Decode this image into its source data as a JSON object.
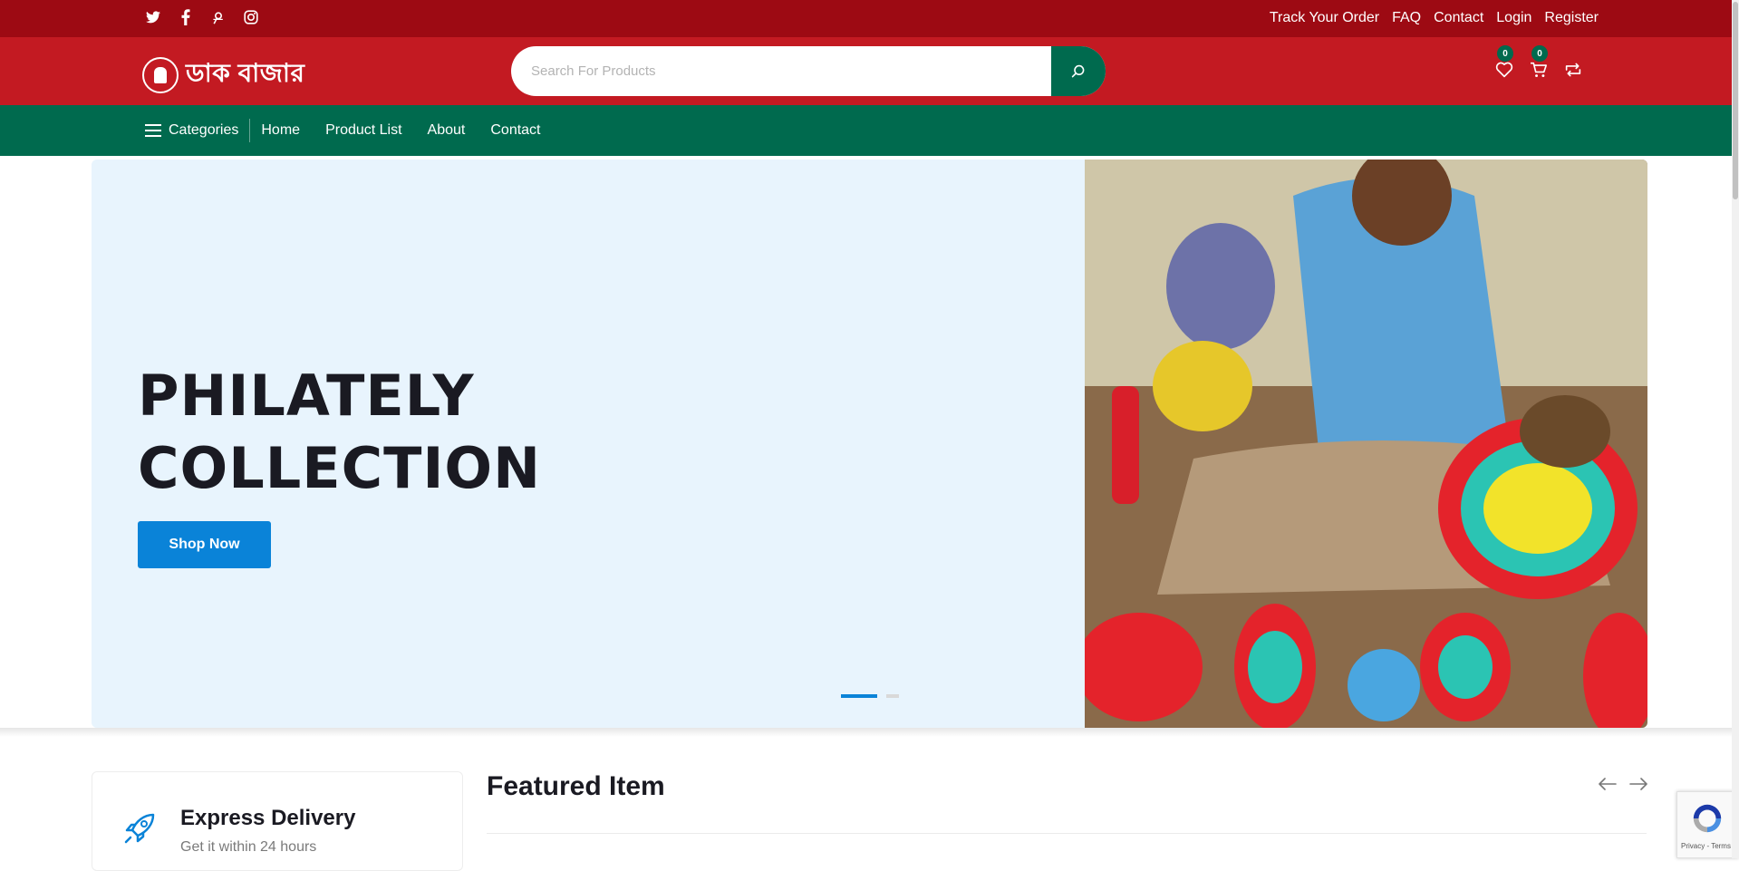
{
  "topbar": {
    "social": [
      "twitter-icon",
      "facebook-icon",
      "pinterest-icon",
      "instagram-icon"
    ],
    "links": [
      "Track Your Order",
      "FAQ",
      "Contact",
      "Login",
      "Register"
    ]
  },
  "header": {
    "logo_text": "ডাক বাজার",
    "search_placeholder": "Search For Products",
    "wishlist_count": "0",
    "cart_count": "0"
  },
  "nav": {
    "categories_label": "Categories",
    "links": [
      "Home",
      "Product List",
      "About",
      "Contact"
    ]
  },
  "hero": {
    "title_line1": "PHILATELY",
    "title_line2": "COLLECTION",
    "button_label": "Shop Now",
    "slides_total": 2,
    "active_slide": 1
  },
  "feature": {
    "title": "Express Delivery",
    "subtitle": "Get it within 24 hours"
  },
  "featured": {
    "title": "Featured Item"
  },
  "recaptcha": {
    "text": "Privacy - Terms"
  },
  "colors": {
    "topbar": "#9d0a13",
    "header": "#c31a22",
    "nav": "#006a4e",
    "accent": "#0a83d8",
    "hero_bg": "#e8f4fd"
  }
}
